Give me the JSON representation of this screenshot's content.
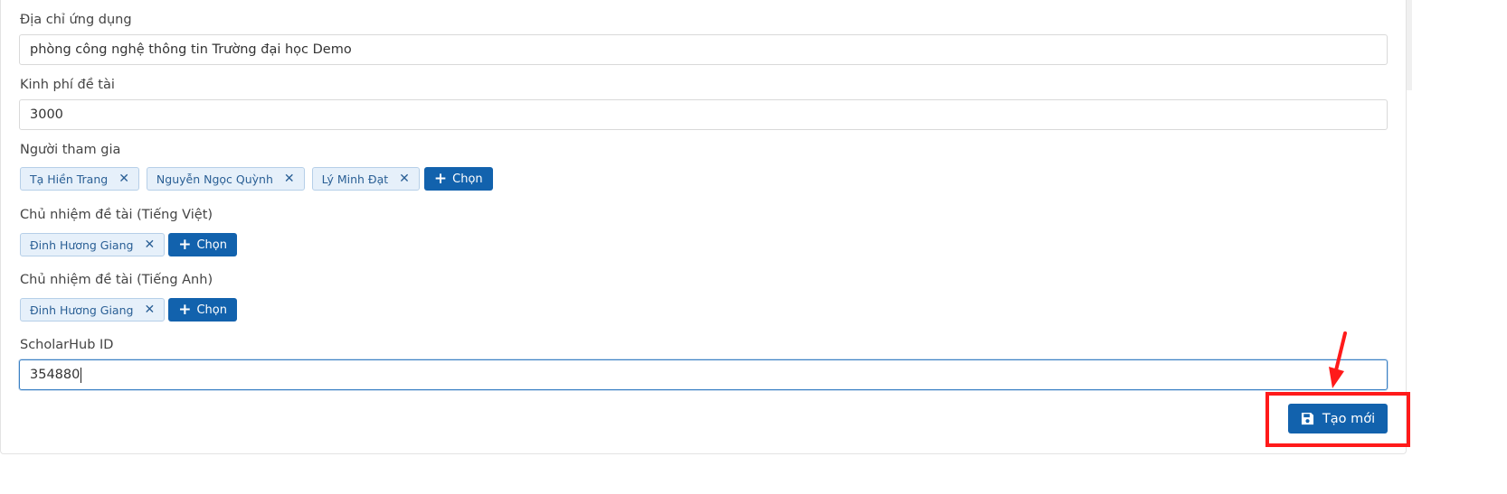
{
  "form": {
    "app_address": {
      "label": "Địa chỉ ứng dụng",
      "value": "phòng công nghệ thông tin Trường đại học Demo"
    },
    "budget": {
      "label": "Kinh phí đề tài",
      "value": "3000"
    },
    "participants": {
      "label": "Người tham gia",
      "items": [
        "Tạ Hiền Trang",
        "Nguyễn Ngọc Quỳnh",
        "Lý Minh Đạt"
      ],
      "select_label": "Chọn"
    },
    "leader_vi": {
      "label": "Chủ nhiệm đề tài (Tiếng Việt)",
      "items": [
        "Đinh Hương Giang"
      ],
      "select_label": "Chọn"
    },
    "leader_en": {
      "label": "Chủ nhiệm đề tài (Tiếng Anh)",
      "items": [
        "Đinh Hương Giang"
      ],
      "select_label": "Chọn"
    },
    "scholarhub": {
      "label": "ScholarHub ID",
      "value": "354880"
    },
    "submit_label": "Tạo mới"
  },
  "colors": {
    "primary": "#1262ad",
    "chip_bg": "#e6f0fa",
    "chip_text": "#2a5f95",
    "annotation": "#ff1a1a"
  },
  "icons": {
    "remove": "close-icon",
    "add": "plus-icon",
    "save": "floppy-disk-icon",
    "annotation": "arrow-icon"
  }
}
